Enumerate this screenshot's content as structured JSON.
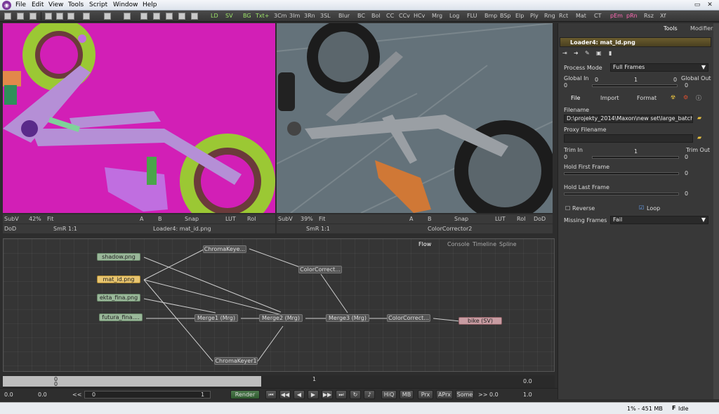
{
  "menubar": {
    "items": [
      "File",
      "Edit",
      "View",
      "Tools",
      "Script",
      "Window",
      "Help"
    ]
  },
  "toolbar": {
    "buttons": [
      "LD",
      "SV",
      "BG",
      "Txt+",
      "3Cm",
      "3Im",
      "3Rn",
      "3SL",
      "Blur",
      "BC",
      "Bol",
      "CC",
      "CCv",
      "HCv",
      "Mrg",
      "Log",
      "FLU",
      "Bmp",
      "BSp",
      "Elp",
      "Ply",
      "Rng",
      "Rct",
      "Mat",
      "CT",
      "pEm",
      "pRn",
      "Rsz",
      "Xf"
    ]
  },
  "viewer_left": {
    "subv": "SubV",
    "zoom": "42%",
    "fit": "Fit",
    "snap": "Snap",
    "lut": "LUT",
    "roi": "RoI",
    "dod": "DoD",
    "smr": "SmR",
    "ratio": "1:1",
    "a_btn": "A",
    "b_btn": "B",
    "title": "Loader4: mat_id.png"
  },
  "viewer_right": {
    "subv": "SubV",
    "zoom": "39%",
    "fit": "Fit",
    "snap": "Snap",
    "lut": "LUT",
    "roi": "RoI",
    "dod": "DoD",
    "smr": "SmR",
    "ratio": "1:1",
    "a_btn": "A",
    "b_btn": "B",
    "title": "ColorCorrector2"
  },
  "flow": {
    "tabs": [
      "Flow",
      "Console",
      "Timeline",
      "Spline"
    ],
    "nodes": [
      {
        "label": "shadow.png"
      },
      {
        "label": "mat_id.png"
      },
      {
        "label": "ekta_fina.png"
      },
      {
        "label": "futura_fina...."
      },
      {
        "label": "ChromaKeye..."
      },
      {
        "label": "ColorCorrect..."
      },
      {
        "label": "Merge1 (Mrg)"
      },
      {
        "label": "Merge2 (Mrg)"
      },
      {
        "label": "Merge3 (Mrg)"
      },
      {
        "label": "ColorCorrect..."
      },
      {
        "label": "bike (SV)"
      },
      {
        "label": "ChromaKeyer1"
      }
    ]
  },
  "timeline": {
    "start_top": "0",
    "start_bot": "0",
    "mid": "1",
    "end": "0.0"
  },
  "transport": {
    "v1": "0.0",
    "v2": "0.0",
    "rew": "<<",
    "cur": "0",
    "last": "1",
    "render": "Render",
    "hiq": "HiQ",
    "mb": "MB",
    "prx": "Prx",
    "aprx": "APrx",
    "some": "Some",
    "ff": ">>",
    "v3": "0.0",
    "v4": "1.0"
  },
  "status": {
    "mem": "1% - 451 MB",
    "state": "Idle"
  },
  "inspector": {
    "tabs": [
      "Tools",
      "Modifiers"
    ],
    "tool_title": "Loader4: mat_id.png",
    "process_mode_label": "Process Mode",
    "process_mode_value": "Full Frames",
    "global_in": "Global In",
    "global_out": "Global Out",
    "global_in_val": "0",
    "global_out_val": "0",
    "global_slider_left": "0",
    "global_slider_mid": "1",
    "global_slider_right": "0",
    "subtabs": [
      "File",
      "Import",
      "Format"
    ],
    "filename_label": "Filename",
    "filename_value": "D:\\projekty_2014\\Maxon\\new set\\large_batch\\bmx\\",
    "proxy_label": "Proxy Filename",
    "trim_in": "Trim In",
    "trim_out": "Trim Out",
    "trim_slider_mid": "1",
    "trim_in_val": "0",
    "trim_out_val": "0",
    "hold_first": "Hold First Frame",
    "hold_first_val": "0",
    "hold_last": "Hold Last Frame",
    "hold_last_val": "0",
    "reverse": "Reverse",
    "loop": "Loop",
    "missing_label": "Missing Frames",
    "missing_value": "Fail"
  }
}
